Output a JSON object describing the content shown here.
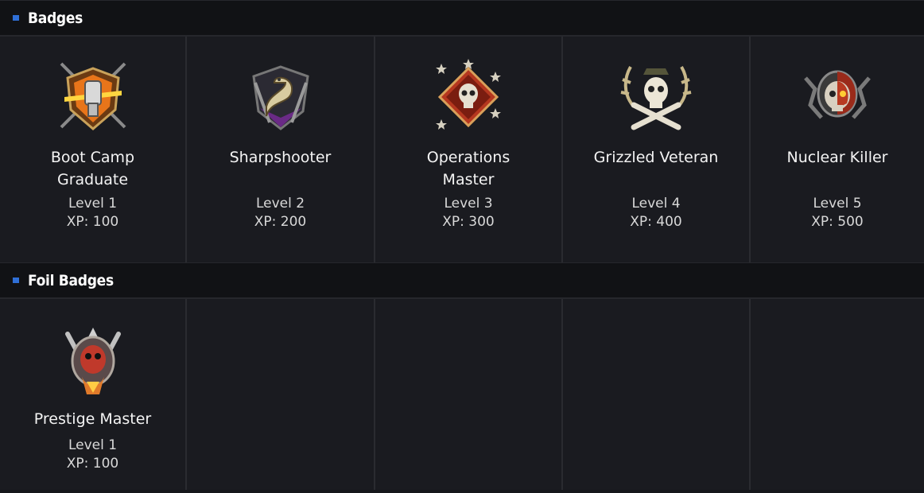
{
  "sections": [
    {
      "title": "Badges",
      "badges": [
        {
          "name": "Boot Camp Graduate",
          "level": "Level 1",
          "xp": "XP: 100",
          "icon": "fist-lightning-shield-icon"
        },
        {
          "name": "Sharpshooter",
          "level": "Level 2",
          "xp": "XP: 200",
          "icon": "snake-shield-icon"
        },
        {
          "name": "Operations Master",
          "level": "Level 3",
          "xp": "XP: 300",
          "icon": "skull-stars-diamond-icon"
        },
        {
          "name": "Grizzled Veteran",
          "level": "Level 4",
          "xp": "XP: 400",
          "icon": "skull-crossbones-antlers-icon"
        },
        {
          "name": "Nuclear Killer",
          "level": "Level 5",
          "xp": "XP: 500",
          "icon": "burning-skull-emblem-icon"
        }
      ]
    },
    {
      "title": "Foil Badges",
      "badges": [
        {
          "name": "Prestige Master",
          "level": "Level 1",
          "xp": "XP: 100",
          "icon": "prestige-skull-emblem-icon"
        }
      ]
    }
  ],
  "colors": {
    "accent": "#2f6fd6",
    "background": "#16171b",
    "cell": "#1a1b20",
    "header": "#111215"
  }
}
